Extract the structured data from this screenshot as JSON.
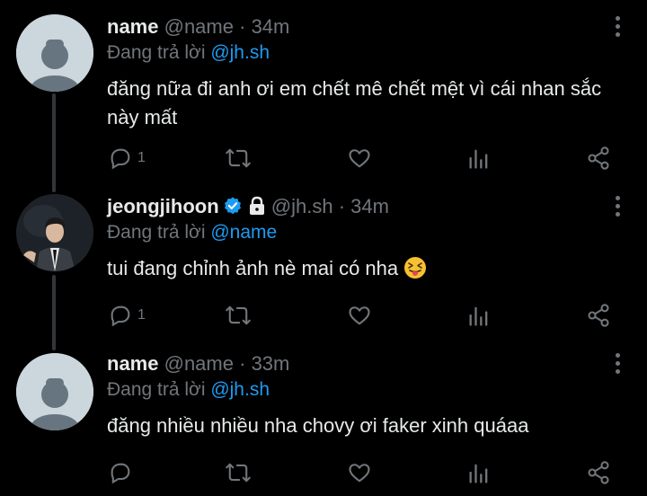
{
  "tweets": [
    {
      "display_name": "name",
      "handle": "@name",
      "separator": "·",
      "time": "34m",
      "replying_prefix": "Đang trả lời",
      "replying_to": "@jh.sh",
      "text": "đăng nữa đi anh ơi em chết mê chết mệt vì cái nhan sắc này mất",
      "reply_count": "1",
      "avatar": "default-avatar"
    },
    {
      "display_name": "jeongjihoon",
      "handle": "@jh.sh",
      "separator": "·",
      "time": "34m",
      "replying_prefix": "Đang trả lời",
      "replying_to": "@name",
      "text": "tui đang chỉnh ảnh nè mai có nha",
      "reply_count": "1",
      "verified": true,
      "protected": true,
      "emoji": "squinting-face-with-tongue",
      "avatar": "profile-photo"
    },
    {
      "display_name": "name",
      "handle": "@name",
      "separator": "·",
      "time": "33m",
      "replying_prefix": "Đang trả lời",
      "replying_to": "@jh.sh",
      "text": "đăng nhiều nhiều nha chovy ơi faker xinh quáaa",
      "reply_count": "",
      "avatar": "default-avatar"
    }
  ],
  "colors": {
    "background": "#000000",
    "text": "#e7e9ea",
    "muted": "#71767b",
    "accent": "#1d9bf0",
    "thread_line": "#333639"
  },
  "icons": [
    "reply-icon",
    "retweet-icon",
    "like-icon",
    "views-icon",
    "share-icon",
    "more-icon",
    "verified-icon",
    "lock-icon"
  ]
}
